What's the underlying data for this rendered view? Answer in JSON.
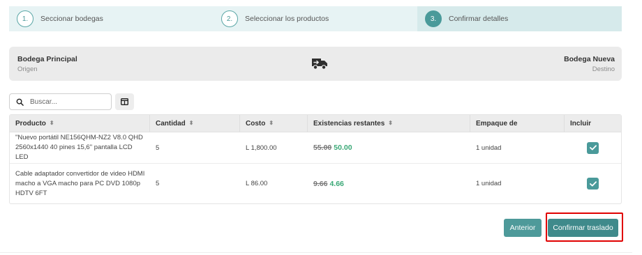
{
  "stepper": {
    "steps": [
      {
        "number": "1.",
        "label": "Seccionar bodegas"
      },
      {
        "number": "2.",
        "label": "Seleccionar los productos"
      },
      {
        "number": "3.",
        "label": "Confirmar detalles"
      }
    ],
    "active_step": 3
  },
  "transfer": {
    "origin_name": "Bodega Principal",
    "origin_label": "Origen",
    "destination_name": "Bodega Nueva",
    "destination_label": "Destino",
    "icon": "truck-arrow-icon"
  },
  "search": {
    "placeholder": "Buscar...",
    "value": ""
  },
  "table": {
    "columns": [
      "Producto",
      "Cantidad",
      "Costo",
      "Existencias restantes",
      "Empaque de",
      "Incluir"
    ],
    "rows": [
      {
        "product": "\"Nuevo portátil NE156QHM-NZ2 V8.0 QHD 2560x1440 40 pines 15,6\" pantalla LCD LED",
        "quantity": "5",
        "cost": "L 1,800.00",
        "stock_before": "55.00",
        "stock_after": "50.00",
        "package": "1 unidad",
        "included": true
      },
      {
        "product": "Cable adaptador convertidor de video HDMI macho a VGA macho para PC DVD 1080p HDTV 6FT",
        "quantity": "5",
        "cost": "L 86.00",
        "stock_before": "9.66",
        "stock_after": "4.66",
        "package": "1 unidad",
        "included": true
      }
    ]
  },
  "actions": {
    "previous_label": "Anterior",
    "confirm_label": "Confirmar traslado"
  },
  "colors": {
    "accent": "#4a9a9a",
    "stepper_bg": "#e7f3f4",
    "stock_new": "#3aa876",
    "highlight": "#e00000"
  }
}
